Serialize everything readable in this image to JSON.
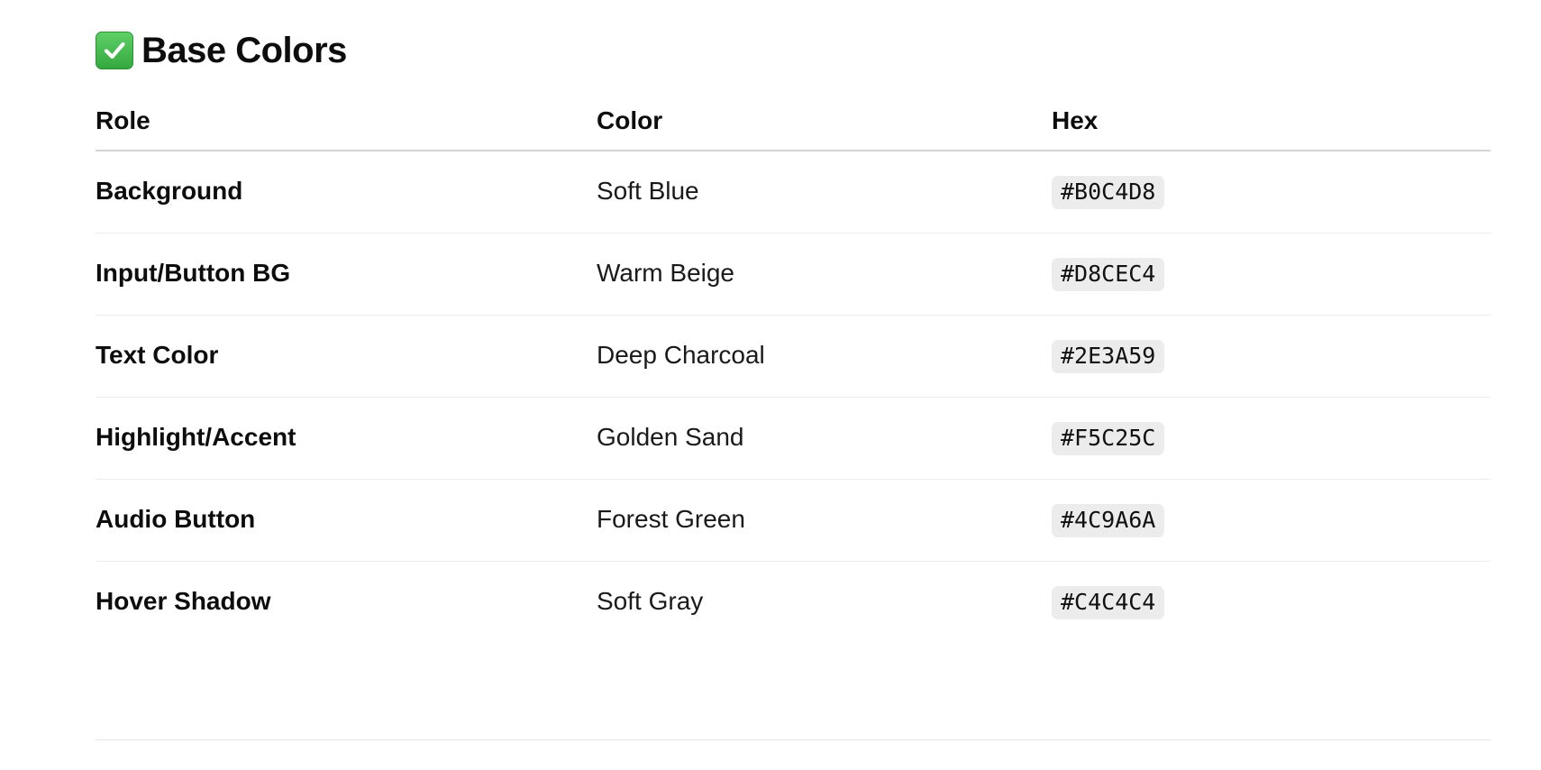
{
  "section": {
    "icon": "check-mark-button-icon",
    "title": "Base Colors"
  },
  "table": {
    "headers": [
      "Role",
      "Color",
      "Hex"
    ],
    "rows": [
      {
        "role": "Background",
        "color": "Soft Blue",
        "hex": "#B0C4D8"
      },
      {
        "role": "Input/Button BG",
        "color": "Warm Beige",
        "hex": "#D8CEC4"
      },
      {
        "role": "Text Color",
        "color": "Deep Charcoal",
        "hex": "#2E3A59"
      },
      {
        "role": "Highlight/Accent",
        "color": "Golden Sand",
        "hex": "#F5C25C"
      },
      {
        "role": "Audio Button",
        "color": "Forest Green",
        "hex": "#4C9A6A"
      },
      {
        "role": "Hover Shadow",
        "color": "Soft Gray",
        "hex": "#C4C4C4"
      }
    ]
  }
}
